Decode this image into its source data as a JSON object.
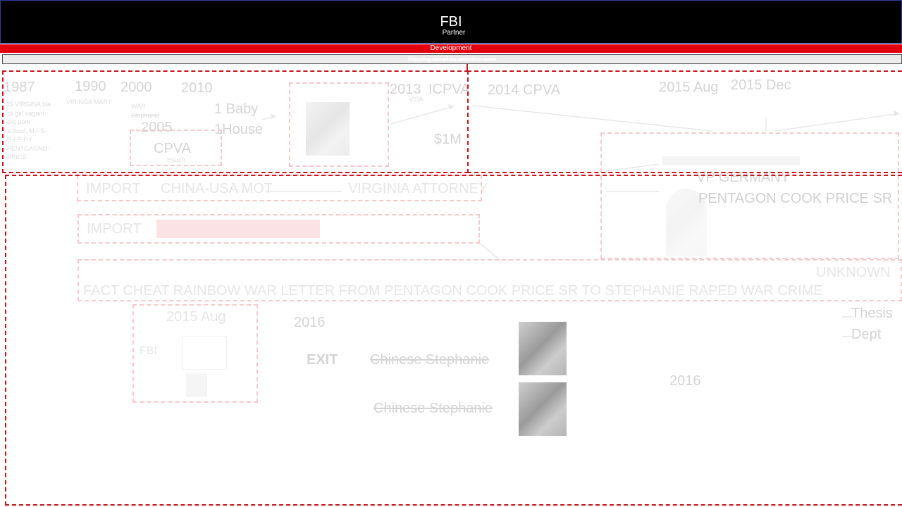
{
  "header": {
    "title": "FBI",
    "subtitle": "Partner"
  },
  "development_bar": {
    "label": "Development"
  },
  "strip": {
    "label": "Slipping out of its attention user"
  },
  "timeline": {
    "y1987": "1987",
    "note1987": [
      "IS VIRGINA bla",
      "ck girl vagani",
      "ore pork",
      "school, M-I-S-",
      "S-I-P-P-I",
      "PENTGAGNO-",
      "PRICE"
    ],
    "y1990": "1990",
    "note1990": "VIRINGA MARY",
    "y2000": "2000",
    "note2000": [
      "WAR",
      "Stephanie"
    ],
    "y2005": "2005",
    "cpva": "CPVA",
    "cpva_note": "Hsuch",
    "y2010": "2010",
    "baby": "1 Baby",
    "house": "1House",
    "y2013": "2013",
    "icpva": "ICPVA",
    "visa": "VISA",
    "million": "$1M",
    "y2014": "2014 CPVA",
    "aug2015": "2015 Aug",
    "dec2015": "2015 Dec"
  },
  "middle": {
    "import1": "IMPORT",
    "china_usa": "CHINA-USA MOT",
    "virginia_attorney": "VIRGINIA ATTORNEY",
    "import2": "IMPORT",
    "vp_germany": "VP GERMANY",
    "pentagon_cook": "PENTAGON COOK PRICE SR",
    "unknown": "UNKNOWN",
    "long_row": "FACT CHEAT RAINBOW WAR LETTER FROM PENTAGON COOK PRICE SR TO STEPHANIE RAPED WAR CRIME"
  },
  "bottom": {
    "aug2015_bottom": "2015 Aug",
    "fbi": "FBI",
    "y2016a": "2016",
    "exit": "EXIT",
    "chinese1": "Chinese Stephanie",
    "chinese2": "Chinese Stephanie",
    "y2016b": "2016",
    "thesis": "Thesis",
    "dept": "Dept"
  },
  "icons": {
    "photo1": "portrait-photo",
    "photo2": "portrait-photo"
  },
  "colors": {
    "header_bg": "#000000",
    "dev_bar": "#e3000e",
    "dashed_frame": "#c8141c"
  }
}
